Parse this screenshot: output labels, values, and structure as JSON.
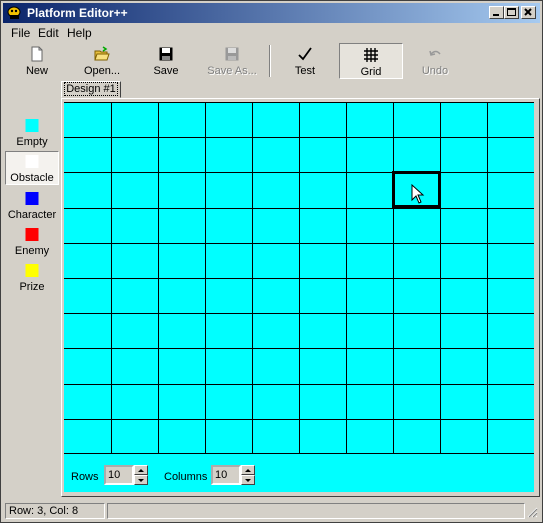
{
  "window": {
    "title": "Platform Editor++"
  },
  "menu": [
    "File",
    "Edit",
    "Help"
  ],
  "toolbar": {
    "new": "New",
    "open": "Open...",
    "save": "Save",
    "save_as": "Save As...",
    "test": "Test",
    "grid": "Grid",
    "undo": "Undo"
  },
  "palette": [
    {
      "label": "Empty",
      "color": "#00ffff"
    },
    {
      "label": "Obstacle",
      "color": "#ffffff"
    },
    {
      "label": "Character",
      "color": "#0000ff"
    },
    {
      "label": "Enemy",
      "color": "#ff0000"
    },
    {
      "label": "Prize",
      "color": "#ffff00"
    }
  ],
  "tab": {
    "label": "Design #1"
  },
  "grid": {
    "rows": 10,
    "columns": 10,
    "selected_row": 3,
    "selected_col": 8,
    "cell_color": "#00ffff"
  },
  "controls": {
    "rows_label": "Rows",
    "rows_value": "10",
    "columns_label": "Columns",
    "columns_value": "10"
  },
  "status": {
    "text": "Row: 3, Col: 8"
  }
}
